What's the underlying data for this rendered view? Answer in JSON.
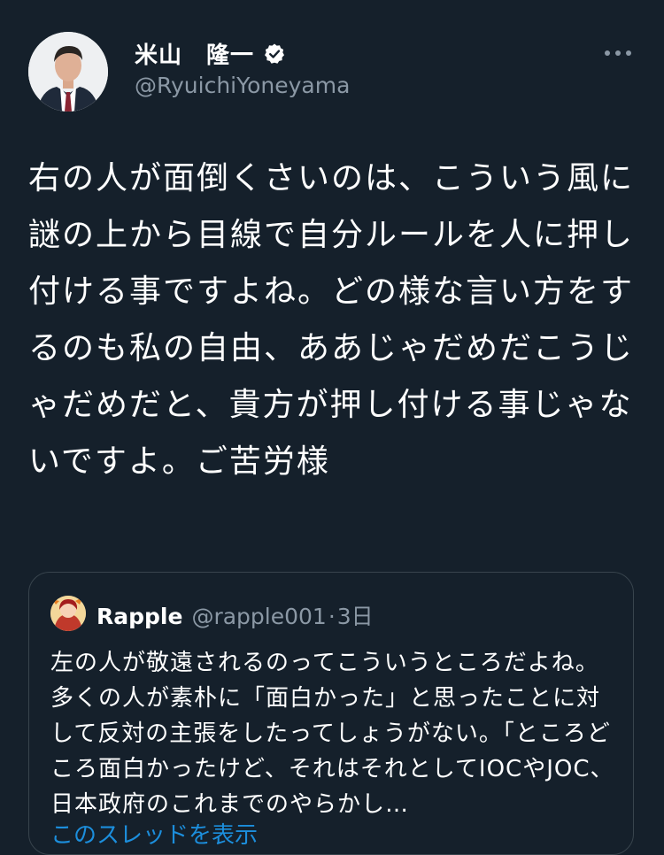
{
  "tweet": {
    "author": {
      "display_name": "米山　隆一",
      "handle": "@RyuichiYoneyama",
      "avatar_icon": "person-portrait",
      "verified_icon": "verified-badge-icon"
    },
    "more_icon": "more-options-icon",
    "text": "右の人が面倒くさいのは、こういう風に謎の上から目線で自分ルールを人に押し付ける事ですよね。どの様な言い方をするのも私の自由、ああじゃだめだこうじゃだめだと、貴方が押し付ける事じゃないですよ。ご苦労様"
  },
  "quote": {
    "author": {
      "display_name": "Rapple",
      "handle": "@rapple001",
      "separator": "·",
      "time": "3日",
      "avatar_icon": "anime-character-avatar"
    },
    "text": "左の人が敬遠されるのってこういうところだよね。多くの人が素朴に「面白かった」と思ったことに対して反対の主張をしたってしょうがない。「ところどころ面白かったけど、それはそれとしてIOCやJOC、日本政府のこれまでのやらかし…",
    "show_more": "このスレッドを表示"
  },
  "colors": {
    "background": "#15202b",
    "text_primary": "#ffffff",
    "text_secondary": "#8b98a5",
    "border": "#38444d",
    "accent": "#1d9bf0"
  }
}
